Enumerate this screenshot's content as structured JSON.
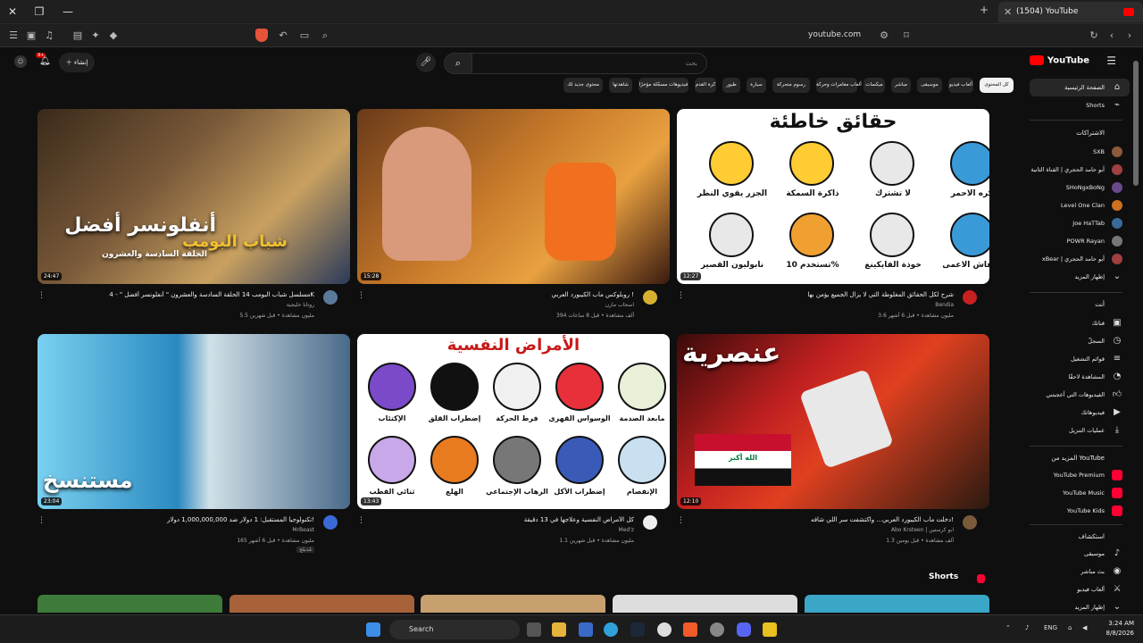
{
  "browser": {
    "tab_title": "(1504) YouTube",
    "url": "youtube.com",
    "shield_badge": "99+"
  },
  "masthead": {
    "logo": "YouTube",
    "logo_sup": "SA",
    "search_placeholder": "بحث",
    "create_label": "إنشاء",
    "notif_count": "9+"
  },
  "chips": [
    "كل المحتوى",
    "ألعاب فيديو",
    "موسيقى",
    "مباشر",
    "ميكسات",
    "ألعاب مغامرات وحركة",
    "رسوم متحركة",
    "سيارة",
    "طيور",
    "كرة القدم",
    "فيديوهات مسجّلة مؤخرًا",
    "شاهدتها",
    "محتوى جديد لك"
  ],
  "sidebar": {
    "main": [
      {
        "label": "الصفحة الرئيسية",
        "icon": "home-icon"
      },
      {
        "label": "Shorts",
        "icon": "shorts-icon"
      }
    ],
    "subs_title": "الاشتراكات",
    "subs": [
      {
        "label": "SXB",
        "color": "#8a5a3a"
      },
      {
        "label": "أبو حامد الحجري | القناة الثانية",
        "color": "#a04040"
      },
      {
        "label": "SHoNgxBoNg",
        "color": "#6a4a8a"
      },
      {
        "label": "Level One Clan",
        "color": "#d07020"
      },
      {
        "label": "Joe HaTTab",
        "color": "#3a6a9a"
      },
      {
        "label": "POWR Rayan",
        "color": "#777777"
      },
      {
        "label": "xBear | أبو حامد الحجري",
        "color": "#a04040"
      },
      {
        "label": "إظهار المزيد",
        "color": ""
      }
    ],
    "you_title": "أنت",
    "you": [
      {
        "label": "قناتك",
        "icon": "channel-icon"
      },
      {
        "label": "السجلّ",
        "icon": "history-icon"
      },
      {
        "label": "قوائم التشغيل",
        "icon": "playlist-icon"
      },
      {
        "label": "المشاهدة لاحقًا",
        "icon": "watch-later-icon"
      },
      {
        "label": "الفيديوهات التي أعجبتني",
        "icon": "like-icon"
      },
      {
        "label": "فيديوهاتك",
        "icon": "video-icon"
      },
      {
        "label": "عمليات التنزيل",
        "icon": "download-icon"
      }
    ],
    "more_title": "المزيد من YouTube",
    "more": [
      {
        "label": "YouTube Premium",
        "color": "#f03"
      },
      {
        "label": "YouTube Music",
        "color": "#f03"
      },
      {
        "label": "YouTube Kids",
        "color": "#f03"
      }
    ],
    "explore_title": "استكشاف",
    "explore": [
      {
        "label": "موسيقى",
        "icon": "music-icon"
      },
      {
        "label": "بث مباشر",
        "icon": "live-icon"
      },
      {
        "label": "ألعاب فيديو",
        "icon": "gaming-icon"
      },
      {
        "label": "إظهار المزيد",
        "icon": "chevron-down-icon"
      }
    ]
  },
  "videos": [
    {
      "duration": "24:47",
      "title": "مسلسل شباب البومب 14 الحلقة السادسة والعشرون \" أنفلونسر أفضل \" - 4K",
      "channel": "روتانا خليجية",
      "meta": "5.5 مليون مشاهدة • قبل شهرين",
      "overlay1": "أنفلونسر أفضل",
      "overlay2": "الحلقة السادسة والعشرون",
      "overlay3": "شباب البومب"
    },
    {
      "duration": "15:28",
      "title": "روبلوكس ماب الكيبورد العربي !",
      "channel": "اسحاب مازن",
      "meta": "394 ألف مشاهدة • قبل 8 ساعات"
    },
    {
      "duration": "12:27",
      "title": "شرح لكل الحقائق المغلوطة التي لا يزال الجميع يؤمن بها",
      "channel": "Bendia",
      "meta": "3.6 مليون مشاهدة • قبل 6 أشهر",
      "overlay1": "حقائق خاطئة",
      "cells": [
        "يكره الاحمر",
        "لا تشترك",
        "ذاكرة السمكة",
        "الجزر يقوي النظر",
        "الخفاش الاعمى",
        "خوذة الفايكينغ",
        "تستخدم 10%",
        "نابوليون القصير"
      ]
    },
    {
      "duration": "23:04",
      "title": "تكنولوجيا المستقبل: 1 دولار ضد 1,000,000,000 دولار!",
      "channel": "MrBeast",
      "meta": "165 مليون مشاهدة • قبل 6 أشهر",
      "overlay1": "مستنسخ",
      "tag": "مُدبلج"
    },
    {
      "duration": "13:43",
      "title": "كل الأمراض النفسية وعلاجها في 13 دقيقة",
      "channel": "Med'z",
      "meta": "1.1 مليون مشاهدة • قبل شهرين",
      "overlay1": "الأمراض النفسية",
      "cells": [
        "مابعد الصدمة",
        "الوسواس القهري",
        "فرط الحركة",
        "إضطراب القلق",
        "الإكتئاب",
        "الإنفصام",
        "إضطراب الأكل",
        "الرهاب الإجتماعي",
        "الهلع",
        "ثنائي القطب"
      ]
    },
    {
      "duration": "12:10",
      "title": "دخلت ماب الكيبورد العربي... واكتشفت سر اللي شافه!",
      "channel": "Abo Krsteen | ابو كرستين",
      "meta": "1.3 ألف مشاهدة • قبل يومين",
      "overlay1": "عنصرية",
      "flag_text": "الله أكبر"
    }
  ],
  "shorts_title": "Shorts",
  "taskbar": {
    "search": "Search",
    "lang": "ENG",
    "time": "3:24 AM",
    "date": "8/8/2026"
  }
}
